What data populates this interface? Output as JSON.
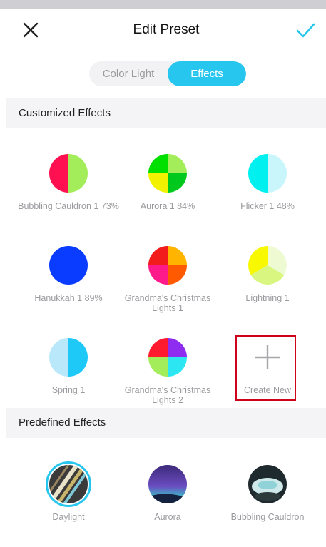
{
  "header": {
    "title": "Edit Preset",
    "close_icon": "close-x-icon",
    "done_icon": "checkmark-icon",
    "accent_color": "#27c6ef"
  },
  "segmented": {
    "options": [
      "Color Light",
      "Effects"
    ],
    "selected": "Effects"
  },
  "customized": {
    "heading": "Customized Effects",
    "items": [
      {
        "label": "Bubbling Cauldron 1 73%",
        "colors": [
          "#ff1050",
          "#a4ed5a"
        ]
      },
      {
        "label": "Aurora 1 84%",
        "colors": [
          "#00e000",
          "#a4ed5a",
          "#f2f200",
          "#00c81c"
        ]
      },
      {
        "label": "Flicker 1 48%",
        "colors": [
          "#00f0f0",
          "#c8f6fb"
        ]
      },
      {
        "label": "Hanukkah 1 89%",
        "colors": [
          "#0a3cff"
        ]
      },
      {
        "label": "Grandma's Christmas Lights 1",
        "colors": [
          "#f21c1c",
          "#ffb400",
          "#ff1a8c",
          "#ff5a00"
        ]
      },
      {
        "label": "Lightning 1",
        "colors": [
          "#f8f800",
          "#eefbd2",
          "#d8f680"
        ]
      },
      {
        "label": "Spring 1",
        "colors": [
          "#b9e8fb",
          "#1ec9f7"
        ]
      },
      {
        "label": "Grandma's Christmas Lights 2",
        "colors": [
          "#ff1a30",
          "#8e2df0",
          "#a4ed5a",
          "#2ce6f2"
        ]
      }
    ],
    "create_new": {
      "label": "Create New",
      "icon": "plus-icon"
    }
  },
  "predefined": {
    "heading": "Predefined Effects",
    "items": [
      {
        "label": "Daylight",
        "selected": true
      },
      {
        "label": "Aurora",
        "selected": false
      },
      {
        "label": "Bubbling Cauldron",
        "selected": false
      }
    ]
  }
}
